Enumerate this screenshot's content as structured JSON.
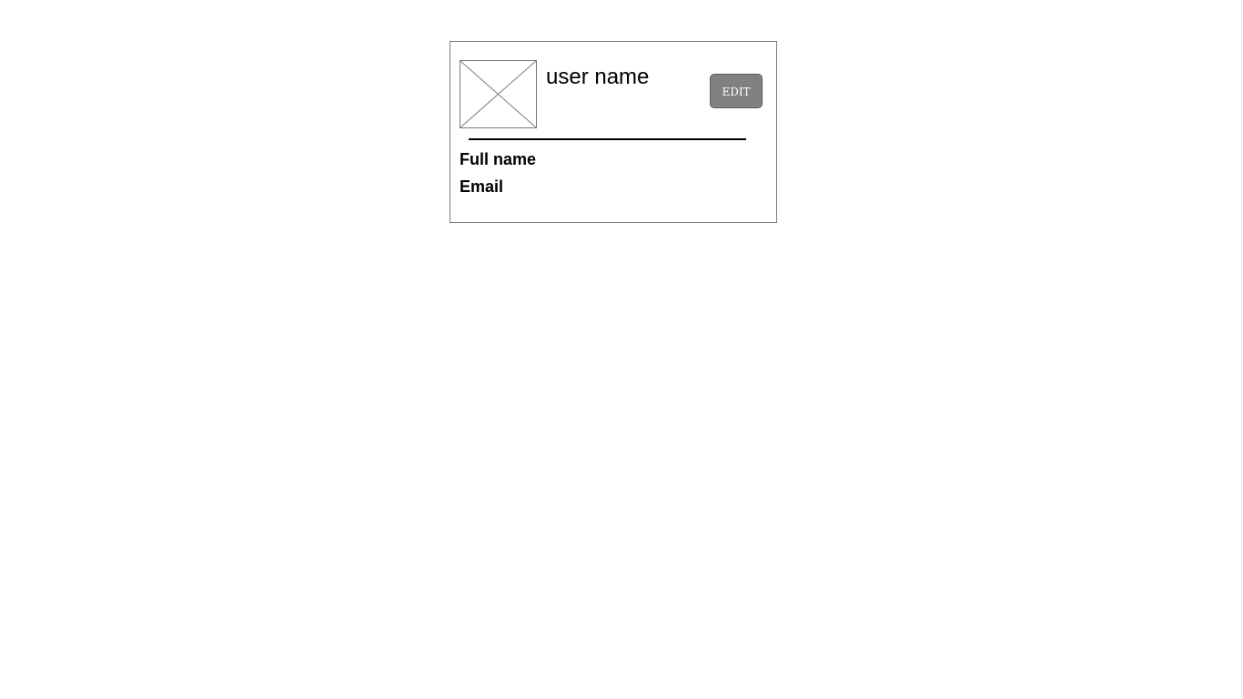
{
  "profile_card": {
    "username": "user name",
    "edit_label": "EDIT",
    "avatar_icon": "image-placeholder-icon",
    "fields": [
      {
        "label": "Full name"
      },
      {
        "label": "Email"
      }
    ]
  },
  "colors": {
    "background": "#ffffff",
    "card_border": "#7a7a7a",
    "edit_button_bg": "#808080",
    "edit_button_text": "#ffffff",
    "divider": "#000000",
    "text": "#000000"
  }
}
